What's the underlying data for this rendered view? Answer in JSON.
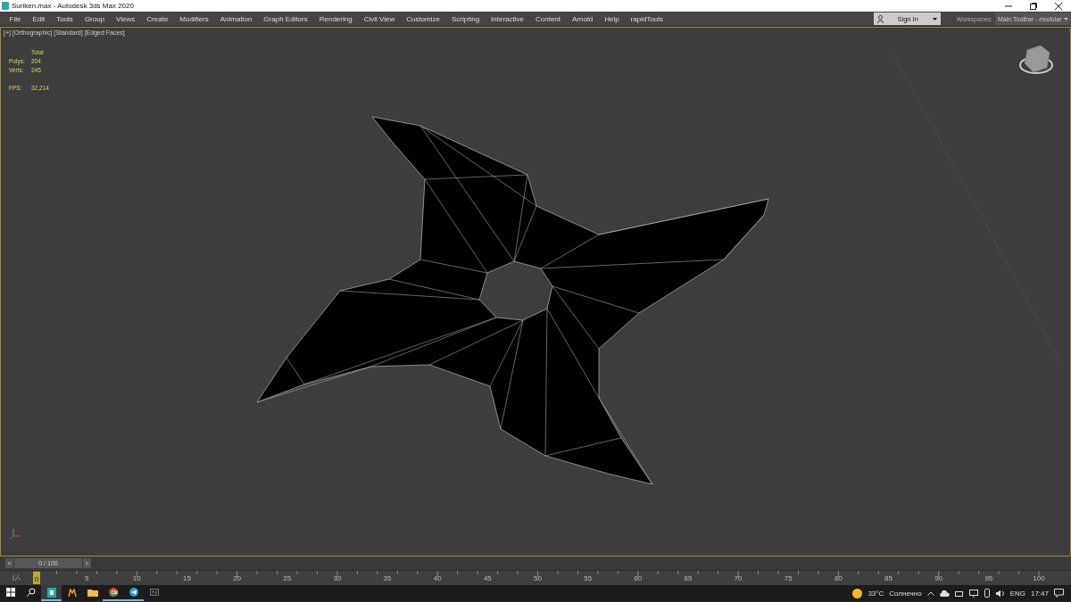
{
  "window": {
    "title": "Suriken.max - Autodesk 3ds Max 2020"
  },
  "menu": [
    "File",
    "Edit",
    "Tools",
    "Group",
    "Views",
    "Create",
    "Modifiers",
    "Animation",
    "Graph Editors",
    "Rendering",
    "Civil View",
    "Customize",
    "Scripting",
    "Interactive",
    "Content",
    "Arnold",
    "Help",
    "rapidTools"
  ],
  "sign_in": {
    "label": "Sign In"
  },
  "workspaces": {
    "label": "Workspaces:",
    "value": "Main Toolbar - modular"
  },
  "viewport": {
    "labels": [
      "[+]",
      "[Orthographic]",
      "[Standard]",
      "[Edged Faces]"
    ],
    "stats": {
      "header": "Total",
      "rows": [
        {
          "label": "Polys:",
          "value": "204"
        },
        {
          "label": "Verts:",
          "value": "245"
        }
      ],
      "fps_label": "FPS:",
      "fps": "32,214"
    }
  },
  "time_slider": {
    "prev": "<",
    "position": "0 / 100",
    "next": ">",
    "level": 0
  },
  "ruler": {
    "current": "0",
    "ticks": [
      "5",
      "10",
      "15",
      "20",
      "25",
      "30",
      "35",
      "40",
      "45",
      "50",
      "55",
      "60",
      "65",
      "70",
      "75",
      "80",
      "85",
      "90",
      "95",
      "100"
    ]
  },
  "taskbar": {
    "apps": [
      {
        "kind": "max",
        "selected": true,
        "running": true
      },
      {
        "kind": "m",
        "selected": false,
        "running": false
      },
      {
        "kind": "folder",
        "selected": false,
        "running": false
      },
      {
        "kind": "browser",
        "selected": false,
        "running": true
      },
      {
        "kind": "messenger",
        "selected": false,
        "running": true
      },
      {
        "kind": "n",
        "selected": false,
        "running": false
      }
    ]
  },
  "tray": {
    "temperature": "33°C",
    "weather": "Солнечно",
    "language": "ENG",
    "time": "17:47"
  }
}
